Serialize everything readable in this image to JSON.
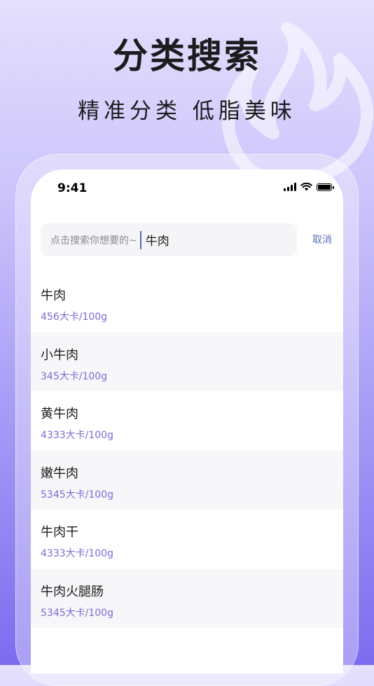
{
  "promo": {
    "headline": "分类搜索",
    "subline": "精准分类 低脂美味"
  },
  "status_bar": {
    "time": "9:41"
  },
  "search": {
    "placeholder": "点击搜索你想要的~",
    "value": "牛肉",
    "cancel_label": "取消"
  },
  "results": [
    {
      "name": "牛肉",
      "calories": "456大卡/100g"
    },
    {
      "name": "小牛肉",
      "calories": "345大卡/100g"
    },
    {
      "name": "黄牛肉",
      "calories": "4333大卡/100g"
    },
    {
      "name": "嫩牛肉",
      "calories": "5345大卡/100g"
    },
    {
      "name": "牛肉干",
      "calories": "4333大卡/100g"
    },
    {
      "name": "牛肉火腿肠",
      "calories": "5345大卡/100g"
    }
  ],
  "colors": {
    "accent": "#7a6bd6",
    "link": "#5a72b6"
  },
  "icons": [
    "flame-icon",
    "signal-icon",
    "wifi-icon",
    "battery-icon"
  ]
}
